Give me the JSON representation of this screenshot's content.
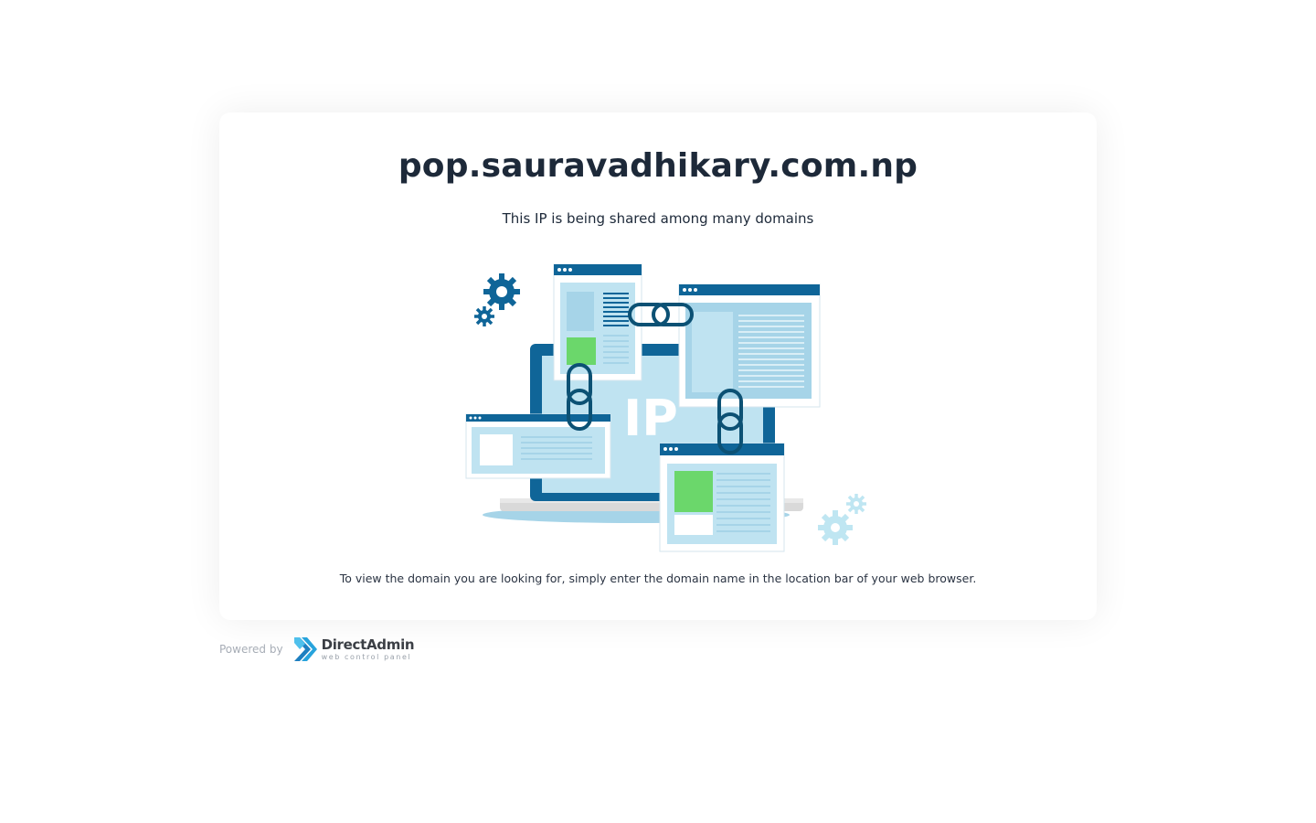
{
  "page": {
    "domain": "pop.sauravadhikary.com.np",
    "subtitle": "This IP is being shared among many domains",
    "hint": "To view the domain you are looking for, simply enter the domain name in the location bar of your web browser."
  },
  "illustration": {
    "label": "IP",
    "icon": "shared-ip-illustration"
  },
  "footer": {
    "powered_by": "Powered by",
    "brand_name": "DirectAdmin",
    "brand_tagline": "web control panel"
  },
  "colors": {
    "title": "#1d2939",
    "dark_blue": "#0f6598",
    "light_blue": "#bfe3f1",
    "mid_blue": "#a6d4e8",
    "green": "#6bd76b",
    "gear_light": "#bfe6f2",
    "da_blue": "#27a3dc"
  }
}
